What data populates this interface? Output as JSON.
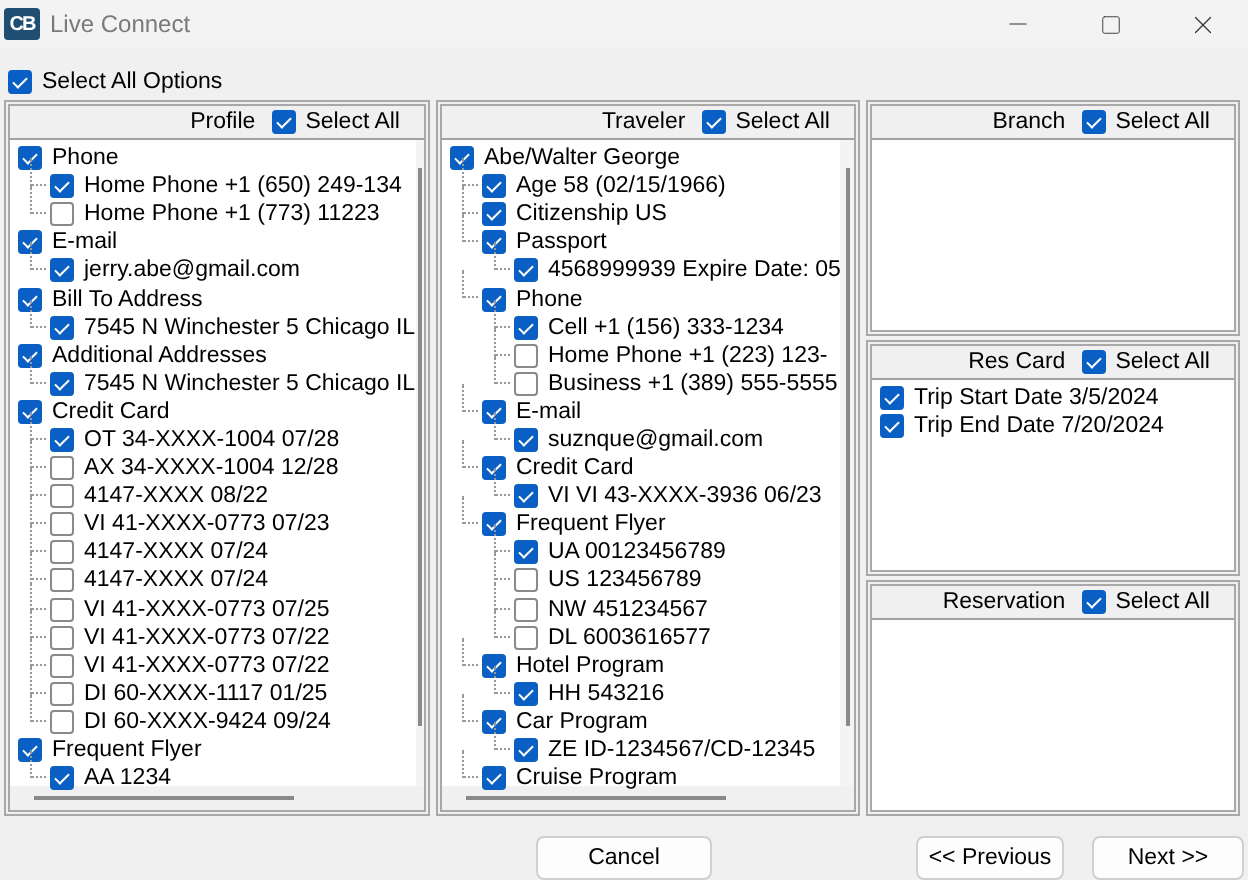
{
  "window": {
    "app_icon": "CB",
    "title": "Live Connect"
  },
  "select_all_options": {
    "label": "Select All Options",
    "checked": true
  },
  "columns": [
    [
      {
        "title": "Profile",
        "select_all": {
          "label": "Select All",
          "checked": true
        },
        "items": [
          {
            "label": "Phone",
            "checked": true,
            "children": [
              {
                "label": "Home Phone +1 (650) 249-134",
                "checked": true
              },
              {
                "label": "Home Phone +1 (773) 11223",
                "checked": false
              }
            ]
          },
          {
            "label": "E-mail",
            "checked": true,
            "children": [
              {
                "label": "jerry.abe@gmail.com",
                "checked": true
              }
            ]
          },
          {
            "label": "Bill To Address",
            "checked": true,
            "children": [
              {
                "label": "7545 N Winchester 5 Chicago IL",
                "checked": true
              }
            ]
          },
          {
            "label": "Additional Addresses",
            "checked": true,
            "children": [
              {
                "label": "7545 N Winchester 5 Chicago IL",
                "checked": true
              }
            ]
          },
          {
            "label": "Credit Card",
            "checked": true,
            "children": [
              {
                "label": "OT 34-XXXX-1004 07/28",
                "checked": true
              },
              {
                "label": "AX 34-XXXX-1004 12/28",
                "checked": false
              },
              {
                "label": "4147-XXXX 08/22",
                "checked": false
              },
              {
                "label": "VI 41-XXXX-0773 07/23",
                "checked": false
              },
              {
                "label": "4147-XXXX 07/24",
                "checked": false
              },
              {
                "label": "4147-XXXX 07/24",
                "checked": false
              },
              {
                "label": "VI 41-XXXX-0773 07/25",
                "checked": false
              },
              {
                "label": "VI 41-XXXX-0773 07/22",
                "checked": false
              },
              {
                "label": "VI 41-XXXX-0773 07/22",
                "checked": false
              },
              {
                "label": "DI 60-XXXX-1117 01/25",
                "checked": false
              },
              {
                "label": "DI 60-XXXX-9424 09/24",
                "checked": false
              }
            ]
          },
          {
            "label": "Frequent Flyer",
            "checked": true,
            "children": [
              {
                "label": "AA 1234",
                "checked": true
              }
            ]
          }
        ]
      }
    ],
    [
      {
        "title": "Traveler",
        "select_all": {
          "label": "Select All",
          "checked": true
        },
        "items": [
          {
            "label": "Abe/Walter George",
            "checked": true,
            "children": [
              {
                "label": "Age 58 (02/15/1966)",
                "checked": true
              },
              {
                "label": "Citizenship US",
                "checked": true
              },
              {
                "label": "Passport",
                "checked": true,
                "children": [
                  {
                    "label": "4568999939 Expire Date: 05",
                    "checked": true
                  }
                ]
              },
              {
                "label": "Phone",
                "checked": true,
                "children": [
                  {
                    "label": "Cell +1 (156) 333-1234",
                    "checked": true
                  },
                  {
                    "label": "Home Phone +1 (223) 123-",
                    "checked": false
                  },
                  {
                    "label": "Business +1 (389) 555-5555",
                    "checked": false
                  }
                ]
              },
              {
                "label": "E-mail",
                "checked": true,
                "children": [
                  {
                    "label": "suznque@gmail.com",
                    "checked": true
                  }
                ]
              },
              {
                "label": "Credit Card",
                "checked": true,
                "children": [
                  {
                    "label": "VI VI 43-XXXX-3936 06/23",
                    "checked": true
                  }
                ]
              },
              {
                "label": "Frequent Flyer",
                "checked": true,
                "children": [
                  {
                    "label": "UA 00123456789",
                    "checked": true
                  },
                  {
                    "label": "US 123456789",
                    "checked": false
                  },
                  {
                    "label": "NW 451234567",
                    "checked": false
                  },
                  {
                    "label": "DL 6003616577",
                    "checked": false
                  }
                ]
              },
              {
                "label": "Hotel Program",
                "checked": true,
                "children": [
                  {
                    "label": "HH 543216",
                    "checked": true
                  }
                ]
              },
              {
                "label": "Car Program",
                "checked": true,
                "children": [
                  {
                    "label": "ZE ID-1234567/CD-12345",
                    "checked": true
                  }
                ]
              },
              {
                "label": "Cruise Program",
                "checked": true
              }
            ]
          }
        ]
      }
    ],
    [
      {
        "title": "Branch",
        "select_all": {
          "label": "Select All",
          "checked": true
        }
      },
      {
        "title": "Res Card",
        "select_all": {
          "label": "Select All",
          "checked": true
        },
        "items": [
          {
            "label": "Trip Start Date 3/5/2024",
            "checked": true
          },
          {
            "label": "Trip End Date 7/20/2024",
            "checked": true
          }
        ]
      },
      {
        "title": "Reservation",
        "select_all": {
          "label": "Select All",
          "checked": true
        }
      }
    ]
  ],
  "buttons": [
    {
      "label": "Cancel"
    },
    {
      "label": "<< Previous"
    },
    {
      "label": "Next >>"
    }
  ]
}
